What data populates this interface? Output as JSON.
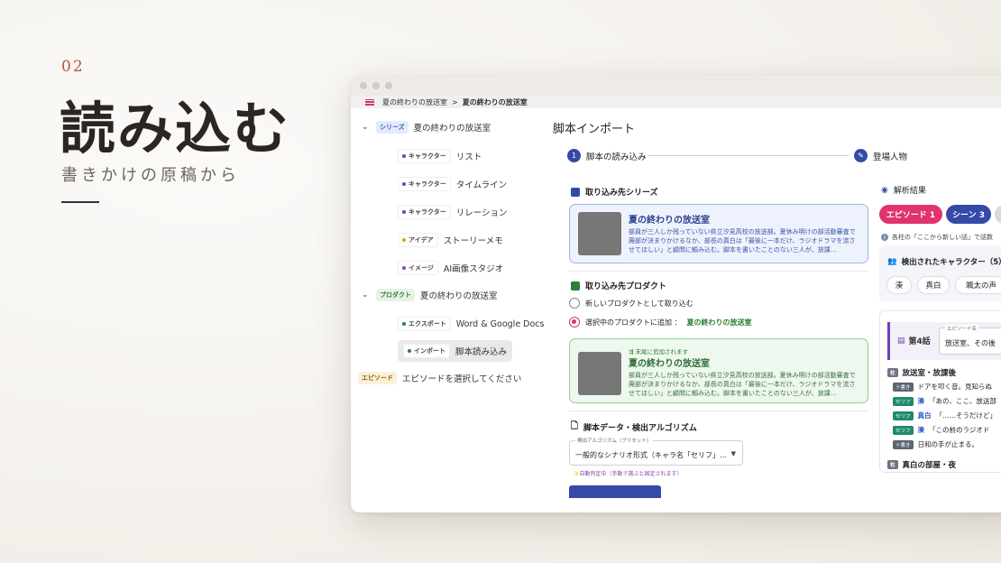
{
  "hero": {
    "number": "02",
    "title": "読み込む",
    "subtitle": "書きかけの原稿から"
  },
  "breadcrumb": {
    "parent": "夏の終わりの放送室",
    "separator": ">",
    "current": "夏の終わりの放送室"
  },
  "sidebar": {
    "series": {
      "tag": "シリーズ",
      "label": "夏の終わりの放送室"
    },
    "series_items": [
      {
        "tag": "キャラクター",
        "label": "リスト",
        "dot": "#3a5bbd"
      },
      {
        "tag": "キャラクター",
        "label": "タイムライン",
        "dot": "#3a5bbd"
      },
      {
        "tag": "キャラクター",
        "label": "リレーション",
        "dot": "#3a5bbd"
      },
      {
        "tag": "アイデア",
        "label": "ストーリーメモ",
        "dot": "#e0a020"
      },
      {
        "tag": "イメージ",
        "label": "AI画像スタジオ",
        "dot": "#8e44ad"
      }
    ],
    "product": {
      "tag": "プロダクト",
      "label": "夏の終わりの放送室"
    },
    "product_items": [
      {
        "tag": "エクスポート",
        "label": "Word & Google Docs",
        "dot": "#2f7d37"
      },
      {
        "tag": "インポート",
        "label": "脚本読み込み",
        "dot": "#2f7d37"
      }
    ],
    "episode": {
      "tag": "エピソード",
      "label": "エピソードを選択してください"
    }
  },
  "main": {
    "title": "脚本インポート",
    "steps": [
      {
        "num": "1",
        "label": "脚本の読み込み"
      },
      {
        "num": "",
        "label": "登場人物"
      }
    ],
    "series_section": "取り込み先シリーズ",
    "series_card": {
      "title": "夏の終わりの放送室",
      "desc": "部員が三人しか残っていない県立汐見高校の放送部。夏休み明けの部活動審査で廃部が決まりかけるなか、部長の真白は「最後に一本だけ、ラジオドラマを流させてほしい」と顧問に頼み込む。脚本を書いたことのない三人が、放課…"
    },
    "product_section": "取り込み先プロダクト",
    "radio_new": "新しいプロダクトとして取り込む",
    "radio_add_prefix": "選択中のプロダクトに追加 ：",
    "radio_add_target": "夏の終わりの放送室",
    "product_card": {
      "note": "末尾に追加されます",
      "title": "夏の終わりの放送室",
      "desc": "部員が三人しか残っていない県立汐見高校の放送部。夏休み明けの部活動審査で廃部が決まりかけるなか、部長の真白は「最後に一本だけ、ラジオドラマを流させてほしい」と顧問に頼み込む。脚本を書いたことのない三人が、放課…"
    },
    "algo_section": "脚本データ・検出アルゴリズム",
    "select_label": "検出アルゴリズム（プリセット）",
    "select_value": "一般的なシナリオ形式（キャラ名「セリフ」…",
    "auto_note": "✨自動判定中（手動で選ぶと固定されます）"
  },
  "results": {
    "title": "解析結果",
    "pills": [
      {
        "label": "エピソード 1",
        "color": "#e0336f"
      },
      {
        "label": "シーン 3",
        "color": "#3449a8"
      },
      {
        "label": "",
        "color": "#d9d9d9"
      }
    ],
    "info": "各柱の「ここから新しい話」で話数",
    "chars_title": "検出されたキャラクター（5）",
    "chars": [
      "湊",
      "真白",
      "颯太の声"
    ],
    "episode_label": "第4話",
    "episode_name_label": "エピソード名",
    "episode_name_value": "放送室、その後",
    "scene1": {
      "tag": "柱",
      "title": "放送室・放課後"
    },
    "lines": [
      {
        "type": "ト書き",
        "kind": "stage",
        "speaker": "",
        "text": "ドアを叩く音。見知らぬ"
      },
      {
        "type": "セリフ",
        "kind": "line",
        "speaker": "湊",
        "text": "「あの、ここ、放送部"
      },
      {
        "type": "セリフ",
        "kind": "line",
        "speaker": "真白",
        "text": "「……そうだけど」"
      },
      {
        "type": "セリフ",
        "kind": "line",
        "speaker": "湊",
        "text": "「この前のラジオド"
      },
      {
        "type": "ト書き",
        "kind": "stage",
        "speaker": "",
        "text": "日和の手が止まる。"
      }
    ],
    "scene2": {
      "tag": "柱",
      "title": "真白の部屋・夜"
    }
  }
}
